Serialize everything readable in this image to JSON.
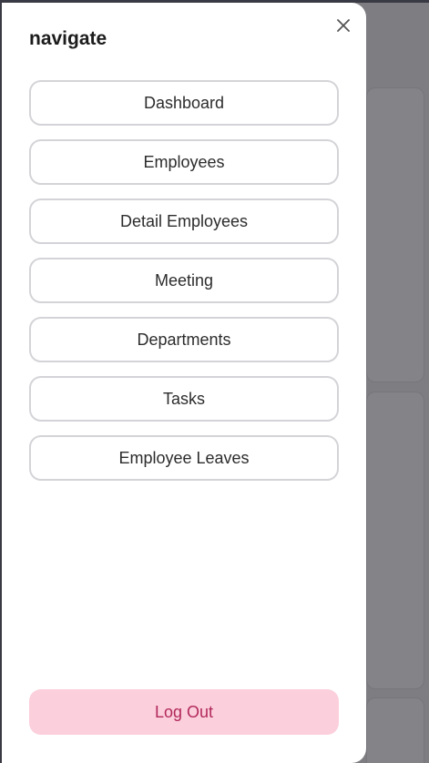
{
  "drawer": {
    "title": "navigate",
    "close_icon": "close-icon",
    "nav_items": [
      {
        "label": "Dashboard"
      },
      {
        "label": "Employees"
      },
      {
        "label": "Detail Employees"
      },
      {
        "label": "Meeting"
      },
      {
        "label": "Departments"
      },
      {
        "label": "Tasks"
      },
      {
        "label": "Employee Leaves"
      }
    ],
    "logout_label": "Log Out"
  },
  "colors": {
    "overlay": "#7d7d82",
    "drawer_bg": "#ffffff",
    "nav_border": "#d4d4d8",
    "logout_bg": "#fbcfdc",
    "logout_text": "#b2285a"
  }
}
